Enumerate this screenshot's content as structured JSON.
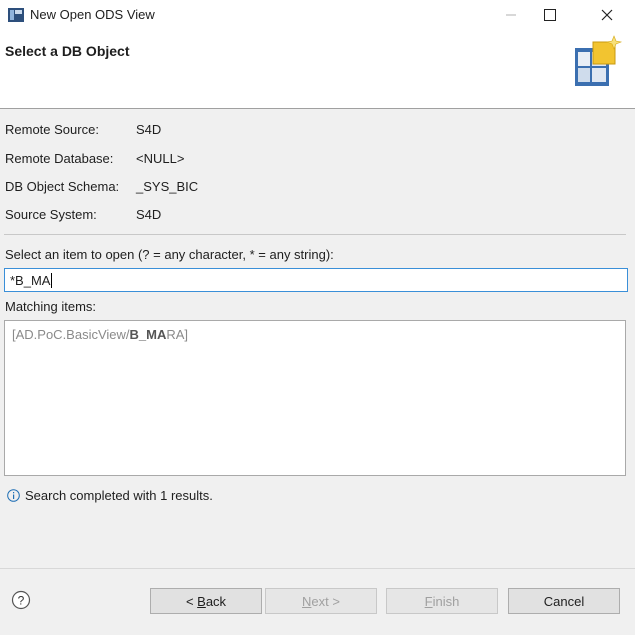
{
  "window": {
    "title": "New Open ODS View",
    "controls": {
      "minimize_icon": "minimize-icon",
      "maximize_icon": "maximize-icon",
      "close_icon": "close-icon"
    }
  },
  "header": {
    "title": "Select a DB Object",
    "icon": "wizard-banner-icon"
  },
  "details": {
    "remote_source": {
      "label": "Remote Source:",
      "value": "S4D"
    },
    "remote_database": {
      "label": "Remote Database:",
      "value": "<NULL>"
    },
    "db_object_schema": {
      "label": "DB Object Schema:",
      "value": "_SYS_BIC"
    },
    "source_system": {
      "label": "Source System:",
      "value": "S4D"
    }
  },
  "search": {
    "label": "Select an item to open (? = any character, * = any string):",
    "value": "*B_MA"
  },
  "matching": {
    "label": "Matching items:",
    "items": [
      {
        "prefix": "[AD.PoC.BasicView/",
        "match": "B_MA",
        "suffix": "RA]"
      }
    ]
  },
  "status": {
    "icon": "info-icon",
    "text": "Search completed with 1 results."
  },
  "footer": {
    "help_icon": "help-icon",
    "buttons": {
      "back": {
        "pre": "< ",
        "mnemonic": "B",
        "post": "ack"
      },
      "next": {
        "pre": "",
        "mnemonic": "N",
        "post": "ext >"
      },
      "finish": {
        "pre": "",
        "mnemonic": "F",
        "post": "inish"
      },
      "cancel": {
        "label": "Cancel"
      }
    }
  }
}
